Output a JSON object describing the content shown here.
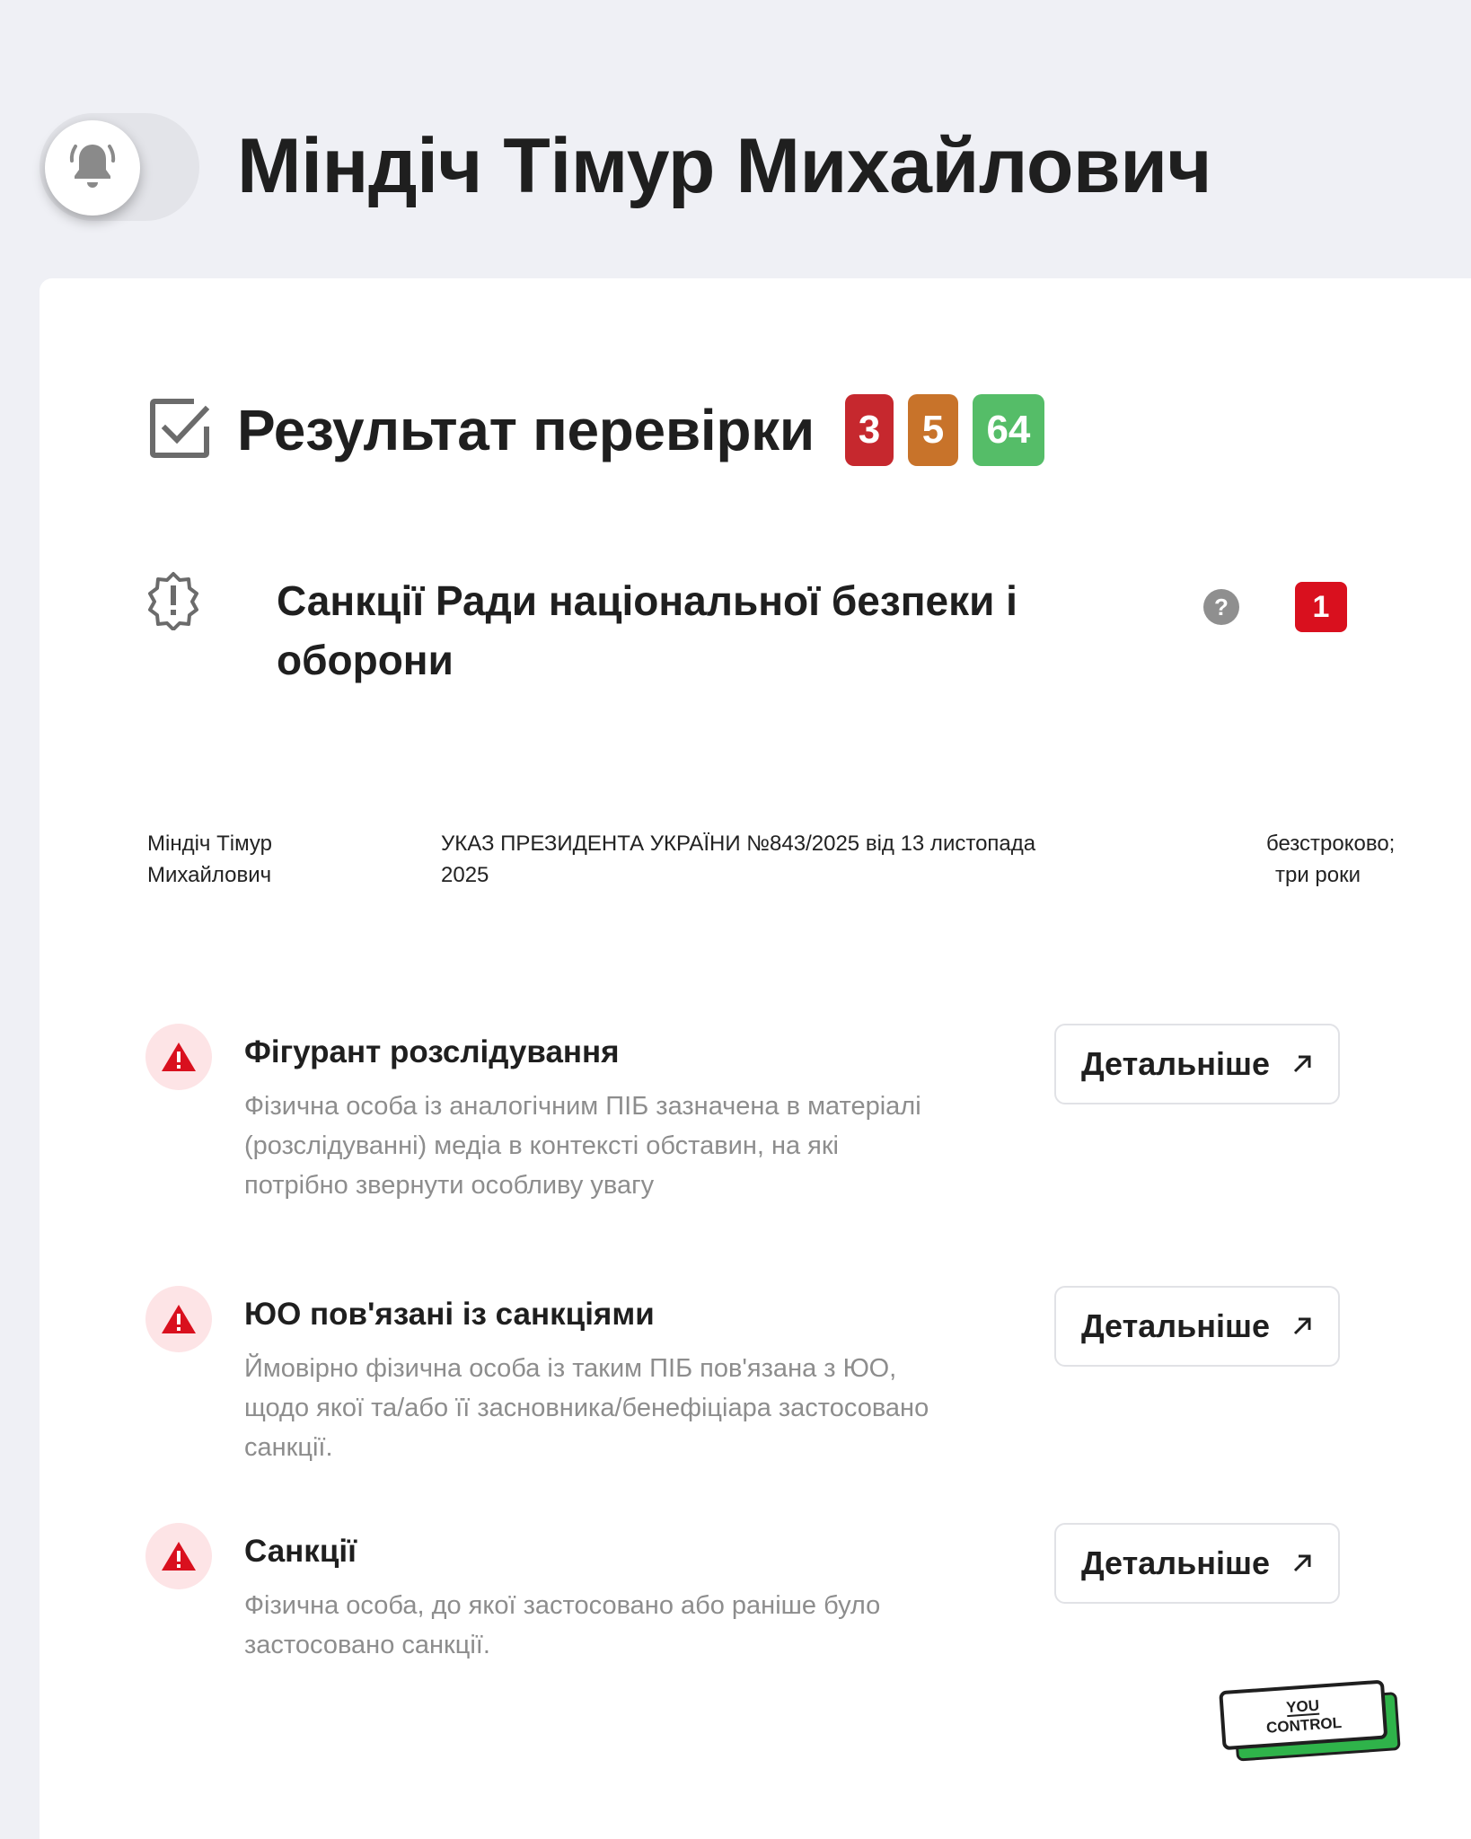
{
  "header": {
    "name": "Міндіч Тімур Михайлович",
    "bell_icon": "bell-icon"
  },
  "result": {
    "title": "Результат перевірки",
    "stats": [
      {
        "value": "3",
        "color": "#c6282e"
      },
      {
        "value": "5",
        "color": "#c8732a"
      },
      {
        "value": "64",
        "color": "#55bd68"
      }
    ]
  },
  "sanction": {
    "title": "Санкції Ради національної безпеки і оборони",
    "count": "1",
    "name_line1": "Міндіч Тімур",
    "name_line2": "Михайлович",
    "decree_line1": "УКАЗ ПРЕЗИДЕНТА УКРАЇНИ №843/2025 від 13 листопада",
    "decree_line2": "2025",
    "term_line1": "безстроково;",
    "term_line2": "три роки"
  },
  "alerts": [
    {
      "title": "Фігурант розслідування",
      "desc_lines": [
        "Фізична особа із аналогічним ПІБ зазначена в матеріалі",
        "(розслідуванні) медіа в контексті обставин, на які",
        "потрібно звернути особливу увагу"
      ],
      "button": "Детальніше"
    },
    {
      "title": "ЮО пов'язані із санкціями",
      "desc_lines": [
        "Ймовірно фізична особа із таким ПІБ пов'язана з ЮО,",
        "щодо якої та/або її засновника/бенефіціара застосовано",
        "санкції."
      ],
      "button": "Детальніше"
    },
    {
      "title": "Санкції",
      "desc_lines": [
        "Фізична особа, до якої застосовано або раніше було",
        "застосовано санкції."
      ],
      "button": "Детальніше"
    }
  ],
  "logo": {
    "line1": "YOU",
    "line2": "CONTROL",
    "accent": "#2fb34a"
  }
}
